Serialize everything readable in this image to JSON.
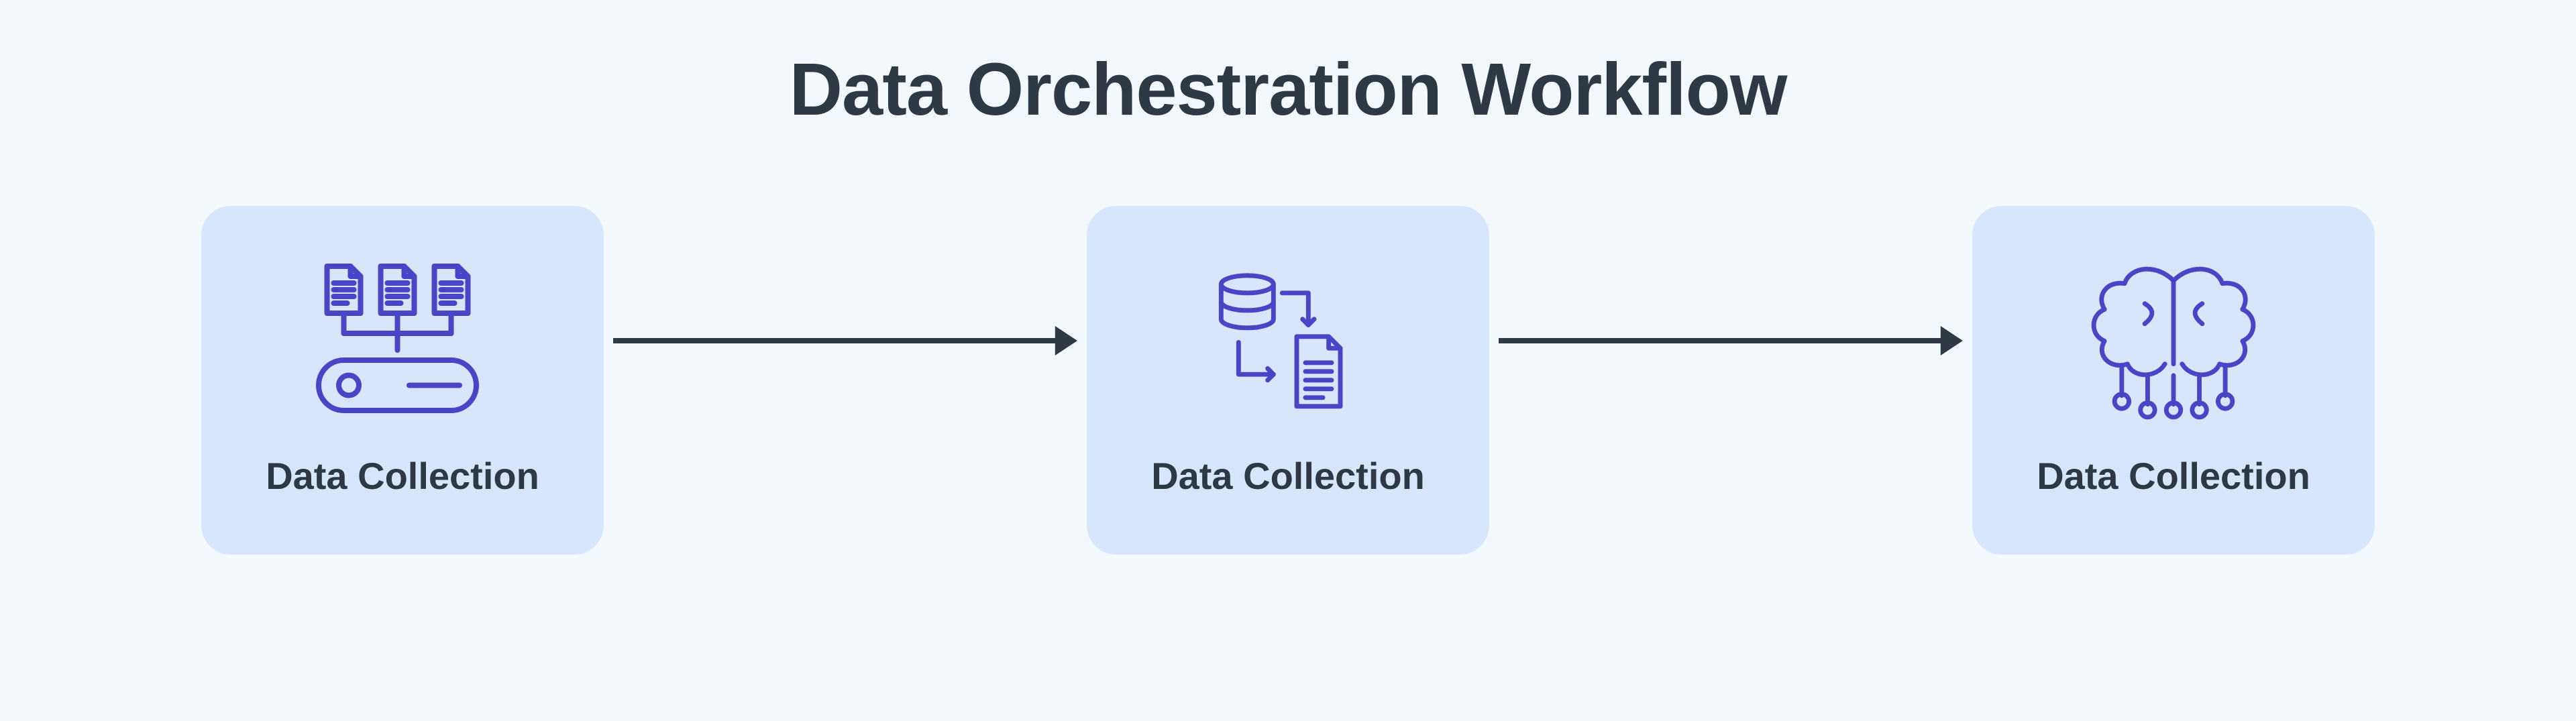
{
  "title": "Data Orchestration Workflow",
  "nodes": [
    {
      "icon": "server-files-icon",
      "label": "Data Collection"
    },
    {
      "icon": "db-to-file-icon",
      "label": "Data Collection"
    },
    {
      "icon": "neural-brain-icon",
      "label": "Data Collection"
    }
  ],
  "colors": {
    "page_bg": "#f3f8fd",
    "card_bg": "#d7e6fb",
    "text": "#2f3944",
    "icon": "#4a44c6",
    "arrow": "#2f3944"
  }
}
